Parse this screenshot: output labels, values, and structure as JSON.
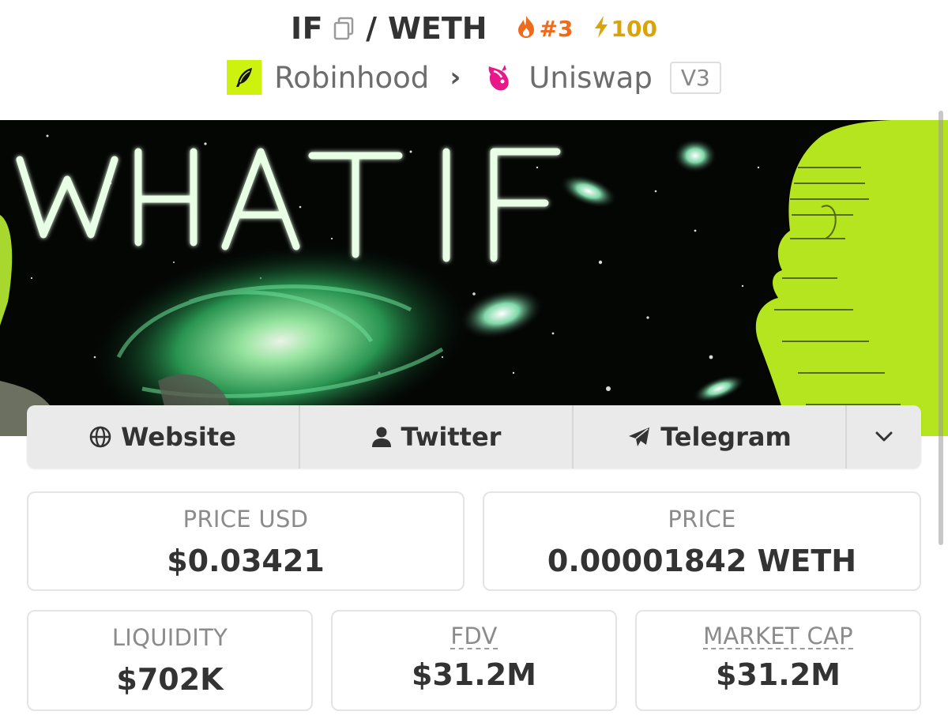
{
  "header": {
    "base_token": "IF",
    "separator": "/",
    "quote_token": "WETH",
    "trending_rank": "#3",
    "boost_count": "100",
    "chain_name": "Robinhood",
    "dex_name": "Uniswap",
    "dex_version": "V3",
    "icons": [
      "copy-icon",
      "flame-icon",
      "lightning-icon",
      "robinhood-feather-icon",
      "chevron-right-icon",
      "uniswap-unicorn-icon"
    ]
  },
  "banner": {
    "text": "WHAT IF"
  },
  "links": {
    "website": "Website",
    "twitter": "Twitter",
    "telegram": "Telegram",
    "icons": [
      "globe-icon",
      "user-icon",
      "send-icon",
      "chevron-down-icon"
    ]
  },
  "stats": {
    "price_usd_label": "PRICE USD",
    "price_usd_value": "$0.03421",
    "price_label": "PRICE",
    "price_value": "0.00001842 WETH",
    "liquidity_label": "LIQUIDITY",
    "liquidity_value": "$702K",
    "fdv_label": "FDV",
    "fdv_value": "$31.2M",
    "mcap_label": "MARKET CAP",
    "mcap_value": "$31.2M"
  },
  "colors": {
    "flame": "#ee6a1d",
    "boost": "#d9a40a",
    "robinhood_green": "#ccf20e",
    "uniswap_pink": "#e8178a"
  }
}
